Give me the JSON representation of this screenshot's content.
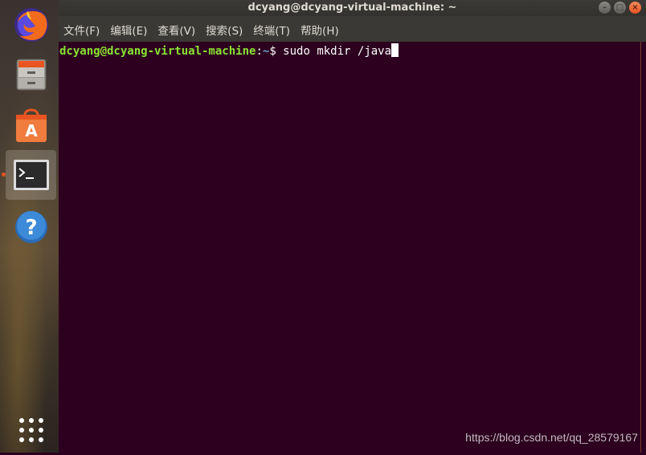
{
  "window": {
    "title": "dcyang@dcyang-virtual-machine: ~"
  },
  "menu": {
    "items": [
      {
        "label": "文件(F)"
      },
      {
        "label": "编辑(E)"
      },
      {
        "label": "查看(V)"
      },
      {
        "label": "搜索(S)"
      },
      {
        "label": "终端(T)"
      },
      {
        "label": "帮助(H)"
      }
    ]
  },
  "terminal": {
    "user_host": "dcyang@dcyang-virtual-machine",
    "colon": ":",
    "path": "~",
    "prompt_char": "$ ",
    "command": "sudo mkdir /java"
  },
  "dock": {
    "items": [
      {
        "icon": "firefox-icon"
      },
      {
        "icon": "files-icon"
      },
      {
        "icon": "software-center-icon"
      },
      {
        "icon": "terminal-icon",
        "active": true
      },
      {
        "icon": "help-icon"
      },
      {
        "icon": "show-applications-icon"
      }
    ]
  },
  "watermark": "https://blog.csdn.net/qq_28579167",
  "colors": {
    "terminal_bg": "#2c001e",
    "prompt_user": "#8ae234",
    "prompt_path": "#729fcf",
    "accent": "#e95420"
  }
}
